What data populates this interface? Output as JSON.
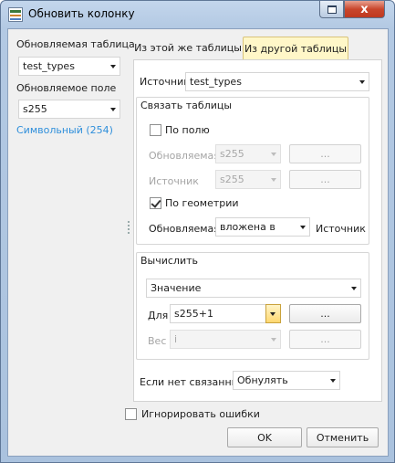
{
  "window": {
    "title": "Обновить колонку",
    "close_glyph": "x"
  },
  "left_panel": {
    "table_label": "Обновляемая таблица",
    "table_value": "test_types",
    "field_label": "Обновляемое поле",
    "field_value": "s255",
    "type_link": "Символьный (254)"
  },
  "tabs": [
    {
      "label": "Из этой же таблицы",
      "active": false
    },
    {
      "label": "Из другой таблицы",
      "active": true
    }
  ],
  "source": {
    "label": "Источник",
    "value": "test_types"
  },
  "link_group": {
    "title": "Связать таблицы",
    "by_field": {
      "label": "По полю",
      "checked": false,
      "updated_label": "Обновляемая",
      "updated_value": "s255",
      "updated_button": "...",
      "source_label": "Источник",
      "source_value": "s255",
      "source_button": "..."
    },
    "by_geometry": {
      "label": "По геометрии",
      "checked": true,
      "updated_label": "Обновляемая",
      "relation_value": "вложена в",
      "source_label": "Источник"
    }
  },
  "compute_group": {
    "title": "Вычислить",
    "mode_value": "Значение",
    "for_label": "Для",
    "for_value": "s255+1",
    "for_button": "...",
    "weight_label": "Вес",
    "weight_value": "i",
    "weight_button": "..."
  },
  "no_link": {
    "label": "Если нет связанных",
    "value": "Обнулять"
  },
  "ignore_errors": {
    "label": "Игнорировать ошибки",
    "checked": false
  },
  "buttons": {
    "ok": "OK",
    "cancel": "Отменить"
  }
}
